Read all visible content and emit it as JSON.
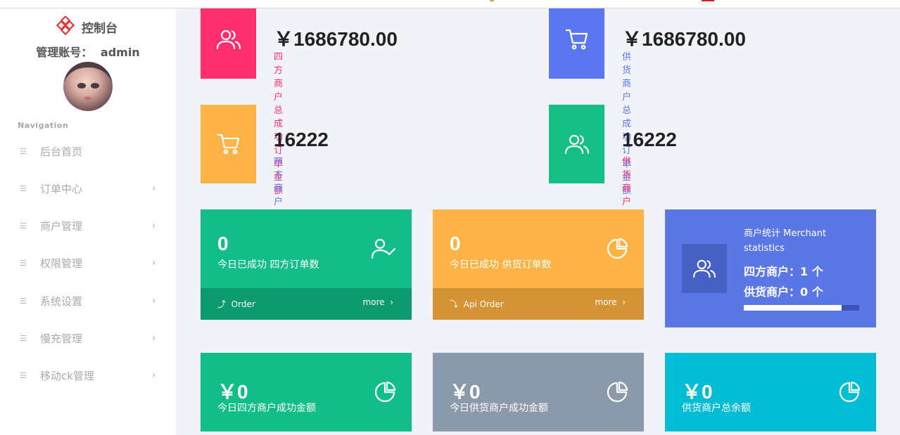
{
  "sidebar": {
    "brand": "控制台",
    "account_label": "管理账号：",
    "account_name": "admin",
    "nav_caption": "Navigation",
    "items": [
      {
        "label": "后台首页",
        "has_children": false
      },
      {
        "label": "订单中心",
        "has_children": true
      },
      {
        "label": "商户管理",
        "has_children": true
      },
      {
        "label": "权限管理",
        "has_children": true
      },
      {
        "label": "系统设置",
        "has_children": true
      },
      {
        "label": "慢充管理",
        "has_children": true
      },
      {
        "label": "移动ck管理",
        "has_children": true
      }
    ]
  },
  "stats": [
    {
      "value": "￥1686780.00",
      "caption": "四方商户总成功订单金额",
      "icon": "users-icon",
      "color": "#ff2f6f",
      "caption_color": "#ff2f6f"
    },
    {
      "value": "￥1686780.00",
      "caption": "供货商户总成功订单金额",
      "icon": "cart-icon",
      "color": "#5b77f0",
      "caption_color": "#5b77f0"
    },
    {
      "value": "16222",
      "caption": "四方商户总成功订单数",
      "icon": "cart-icon",
      "color": "#ffb347",
      "caption_color": "#5b77f0"
    },
    {
      "value": "16222",
      "caption": "供货商户总成功订单数",
      "icon": "users-icon",
      "color": "#14be84",
      "caption_color": "#ff2f6f"
    }
  ],
  "tiles": [
    {
      "value": "0",
      "caption": "今日已成功 四方订单数",
      "icon": "user-check-icon",
      "footer_label": "Order",
      "footer_more": "more",
      "color": "#13be86",
      "footer_color": "#0d9a6c"
    },
    {
      "value": "0",
      "caption": "今日已成功 供货订单数",
      "icon": "pie-chart-icon",
      "footer_label": "Api Order",
      "footer_more": "more",
      "color": "#ffb347",
      "footer_color": "#d49334"
    }
  ],
  "merchant": {
    "title": "商户统计 Merchant statistics",
    "line1": "四方商户：1 个",
    "line2": "供货商户：0 个",
    "progress": 0.85,
    "color": "#5b77e6"
  },
  "amounts": [
    {
      "value": "￥0",
      "caption": "今日四方商户成功金额",
      "icon": "pie-chart-icon",
      "color": "#13be86"
    },
    {
      "value": "￥0",
      "caption": "今日供货商户成功金额",
      "icon": "pie-chart-icon",
      "color": "#8a9aaa"
    },
    {
      "value": "￥0",
      "caption": "供货商户总余额",
      "icon": "pie-chart-icon",
      "color": "#00bcd4"
    }
  ]
}
